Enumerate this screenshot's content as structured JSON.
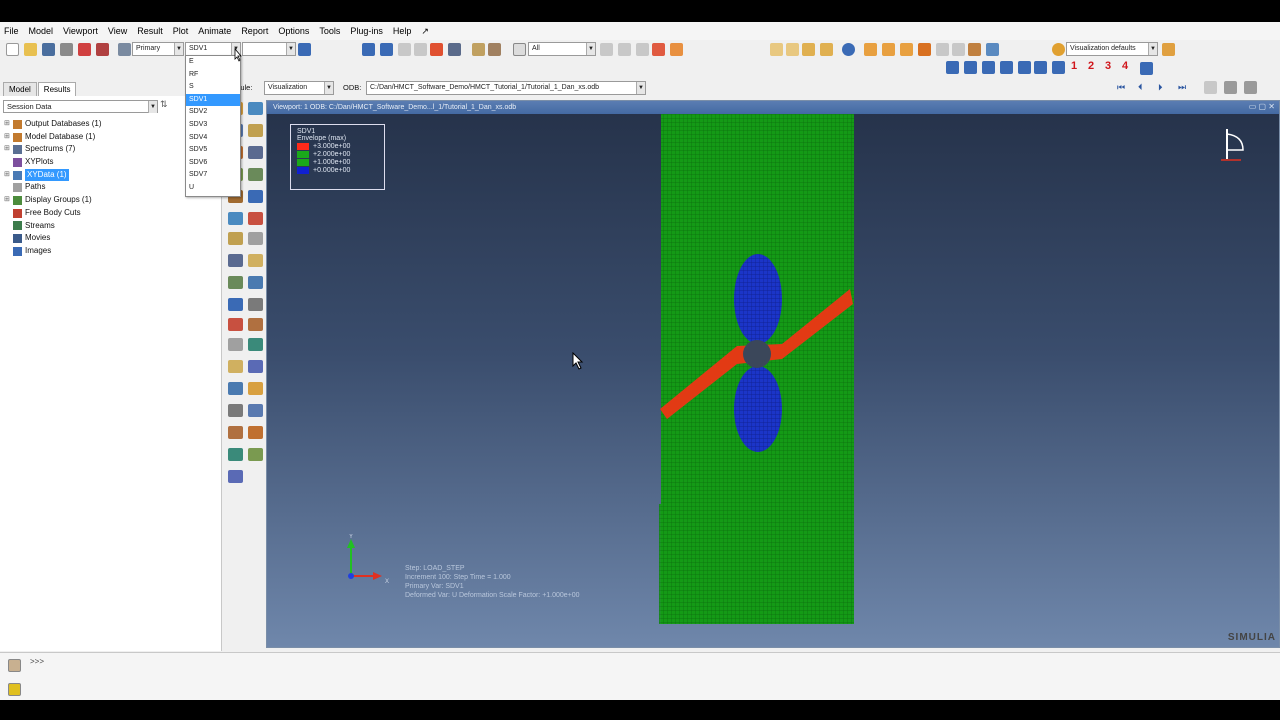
{
  "menubar": [
    "File",
    "Model",
    "Viewport",
    "View",
    "Result",
    "Plot",
    "Animate",
    "Report",
    "Options",
    "Tools",
    "Plug-ins",
    "Help"
  ],
  "help_glyph": "↗",
  "toolbar": {
    "primary_label": "Primary",
    "variable_value": "SDV1",
    "filter_value": "All",
    "visualization_defaults": "Visualization defaults",
    "numbers": [
      "1",
      "2",
      "3",
      "4"
    ]
  },
  "dropdown": {
    "options": [
      "E",
      "RF",
      "S",
      "SDV1",
      "SDV2",
      "SDV3",
      "SDV4",
      "SDV5",
      "SDV6",
      "SDV7",
      "U"
    ],
    "selected": "SDV1"
  },
  "tabs": [
    "Model",
    "Results"
  ],
  "session": {
    "label": "Session Data",
    "tree": [
      {
        "label": "Output Databases (1)",
        "expander": "⊞",
        "color": "#c27a2e"
      },
      {
        "label": "Model Database (1)",
        "expander": "⊞",
        "color": "#c27a2e"
      },
      {
        "label": "Spectrums (7)",
        "expander": "⊞",
        "color": "#5a6f93"
      },
      {
        "label": "XYPlots",
        "expander": "",
        "color": "#7d4f9e"
      },
      {
        "label": "XYData (1)",
        "expander": "⊞",
        "color": "#4a7ab5",
        "highlight": true
      },
      {
        "label": "Paths",
        "expander": "",
        "color": "#a0a0a0"
      },
      {
        "label": "Display Groups (1)",
        "expander": "⊞",
        "color": "#4c8c3c"
      },
      {
        "label": "Free Body Cuts",
        "expander": "",
        "color": "#c04030"
      },
      {
        "label": "Streams",
        "expander": "",
        "color": "#3c7c4c"
      },
      {
        "label": "Movies",
        "expander": "",
        "color": "#3a5a8a"
      },
      {
        "label": "Images",
        "expander": "",
        "color": "#3a6ab5"
      }
    ]
  },
  "context": {
    "module_label": "odule:",
    "module_value": "Visualization",
    "odb_label": "ODB:",
    "odb_value": "C:/Dan/HMCT_Software_Demo/HMCT_Tutorial_1/Tutorial_1_Dan_xs.odb"
  },
  "viewport": {
    "title": "Viewport: 1     ODB: C:/Dan/HMCT_Software_Demo...l_1/Tutorial_1_Dan_xs.odb",
    "legend": {
      "title": "SDV1",
      "subtitle": "Envelope (max)",
      "entries": [
        {
          "value": "+3.000e+00",
          "color": "#ff2a1a"
        },
        {
          "value": "+2.000e+00",
          "color": "#1aa81a"
        },
        {
          "value": "+1.000e+00",
          "color": "#1aa81a"
        },
        {
          "value": "+0.000e+00",
          "color": "#1020d0"
        }
      ]
    },
    "step_info": [
      "Step: LOAD_STEP",
      "Increment    100: Step Time =    1.000",
      "Primary Var: SDV1",
      "Deformed Var: U   Deformation Scale Factor: +1.000e+00"
    ],
    "axis_labels": {
      "y": "Y",
      "x": "X"
    }
  },
  "command": {
    "prompt": ">>>"
  },
  "brand": "SIMULIA"
}
